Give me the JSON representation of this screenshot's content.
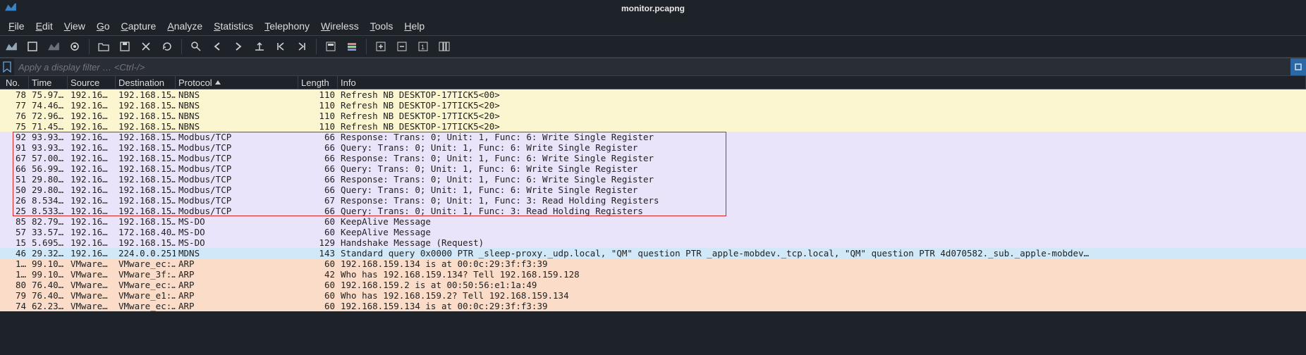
{
  "title": "monitor.pcapng",
  "menu": [
    "File",
    "Edit",
    "View",
    "Go",
    "Capture",
    "Analyze",
    "Statistics",
    "Telephony",
    "Wireless",
    "Tools",
    "Help"
  ],
  "filter_placeholder": "Apply a display filter … <Ctrl-/>",
  "columns": [
    "No.",
    "Time",
    "Source",
    "Destination",
    "Protocol",
    "Length",
    "Info"
  ],
  "sort_column": "Protocol",
  "toolbar_icons": [
    "fin-icon",
    "stop-icon",
    "restart-icon",
    "options-icon",
    "open-icon",
    "save-icon",
    "close-icon",
    "reload-icon",
    "find-icon",
    "back-icon",
    "forward-icon",
    "jump-icon",
    "first-icon",
    "last-icon",
    "autoscroll-icon",
    "colorize-icon",
    "zoom-in-icon",
    "zoom-out-icon",
    "reset-zoom-icon",
    "resize-icon"
  ],
  "packets": [
    {
      "no": "78",
      "time": "75.97…",
      "src": "192.16…",
      "dst": "192.168.15…",
      "proto": "NBNS",
      "len": "110",
      "info": "Refresh NB DESKTOP-17TICK5<00>",
      "cls": "bg-nbns"
    },
    {
      "no": "77",
      "time": "74.46…",
      "src": "192.16…",
      "dst": "192.168.15…",
      "proto": "NBNS",
      "len": "110",
      "info": "Refresh NB DESKTOP-17TICK5<20>",
      "cls": "bg-nbns"
    },
    {
      "no": "76",
      "time": "72.96…",
      "src": "192.16…",
      "dst": "192.168.15…",
      "proto": "NBNS",
      "len": "110",
      "info": "Refresh NB DESKTOP-17TICK5<20>",
      "cls": "bg-nbns"
    },
    {
      "no": "75",
      "time": "71.45…",
      "src": "192.16…",
      "dst": "192.168.15…",
      "proto": "NBNS",
      "len": "110",
      "info": "Refresh NB DESKTOP-17TICK5<20>",
      "cls": "bg-nbns"
    },
    {
      "no": "92",
      "time": "93.93…",
      "src": "192.16…",
      "dst": "192.168.15…",
      "proto": "Modbus/TCP",
      "len": "66",
      "info": "Response: Trans:     0; Unit:   1, Func:   6: Write Single Register",
      "cls": "bg-modbus",
      "hl": true
    },
    {
      "no": "91",
      "time": "93.93…",
      "src": "192.16…",
      "dst": "192.168.15…",
      "proto": "Modbus/TCP",
      "len": "66",
      "info": "   Query: Trans:     0; Unit:   1, Func:   6: Write Single Register",
      "cls": "bg-modbus",
      "hl": true
    },
    {
      "no": "67",
      "time": "57.00…",
      "src": "192.16…",
      "dst": "192.168.15…",
      "proto": "Modbus/TCP",
      "len": "66",
      "info": "Response: Trans:     0; Unit:   1, Func:   6: Write Single Register",
      "cls": "bg-modbus",
      "hl": true
    },
    {
      "no": "66",
      "time": "56.99…",
      "src": "192.16…",
      "dst": "192.168.15…",
      "proto": "Modbus/TCP",
      "len": "66",
      "info": "   Query: Trans:     0; Unit:   1, Func:   6: Write Single Register",
      "cls": "bg-modbus",
      "hl": true
    },
    {
      "no": "51",
      "time": "29.80…",
      "src": "192.16…",
      "dst": "192.168.15…",
      "proto": "Modbus/TCP",
      "len": "66",
      "info": "Response: Trans:     0; Unit:   1, Func:   6: Write Single Register",
      "cls": "bg-modbus",
      "hl": true
    },
    {
      "no": "50",
      "time": "29.80…",
      "src": "192.16…",
      "dst": "192.168.15…",
      "proto": "Modbus/TCP",
      "len": "66",
      "info": "   Query: Trans:     0; Unit:   1, Func:   6: Write Single Register",
      "cls": "bg-modbus",
      "hl": true
    },
    {
      "no": "26",
      "time": "8.534…",
      "src": "192.16…",
      "dst": "192.168.15…",
      "proto": "Modbus/TCP",
      "len": "67",
      "info": "Response: Trans:     0; Unit:   1, Func:   3: Read Holding Registers",
      "cls": "bg-modbus",
      "hl": true
    },
    {
      "no": "25",
      "time": "8.533…",
      "src": "192.16…",
      "dst": "192.168.15…",
      "proto": "Modbus/TCP",
      "len": "66",
      "info": "   Query: Trans:     0; Unit:   1, Func:   3: Read Holding Registers",
      "cls": "bg-modbus",
      "hl": true
    },
    {
      "no": "85",
      "time": "82.79…",
      "src": "192.16…",
      "dst": "192.168.15…",
      "proto": "MS-DO",
      "len": "60",
      "info": "KeepAlive Message",
      "cls": "bg-msdo"
    },
    {
      "no": "57",
      "time": "33.57…",
      "src": "192.16…",
      "dst": "172.168.40…",
      "proto": "MS-DO",
      "len": "60",
      "info": "KeepAlive Message",
      "cls": "bg-msdo"
    },
    {
      "no": "15",
      "time": "5.695…",
      "src": "192.16…",
      "dst": "192.168.15…",
      "proto": "MS-DO",
      "len": "129",
      "info": "Handshake Message (Request)",
      "cls": "bg-msdo"
    },
    {
      "no": "46",
      "time": "29.32…",
      "src": "192.16…",
      "dst": "224.0.0.251",
      "proto": "MDNS",
      "len": "143",
      "info": "Standard query 0x0000 PTR _sleep-proxy._udp.local, \"QM\" question PTR _apple-mobdev._tcp.local, \"QM\" question PTR 4d070582._sub._apple-mobdev…",
      "cls": "bg-mdns"
    },
    {
      "no": "1…",
      "time": "99.10…",
      "src": "VMware…",
      "dst": "VMware_ec:…",
      "proto": "ARP",
      "len": "60",
      "info": "192.168.159.134 is at 00:0c:29:3f:f3:39",
      "cls": "bg-arp"
    },
    {
      "no": "1…",
      "time": "99.10…",
      "src": "VMware…",
      "dst": "VMware_3f:…",
      "proto": "ARP",
      "len": "42",
      "info": "Who has 192.168.159.134? Tell 192.168.159.128",
      "cls": "bg-arp"
    },
    {
      "no": "80",
      "time": "76.40…",
      "src": "VMware…",
      "dst": "VMware_ec:…",
      "proto": "ARP",
      "len": "60",
      "info": "192.168.159.2 is at 00:50:56:e1:1a:49",
      "cls": "bg-arp"
    },
    {
      "no": "79",
      "time": "76.40…",
      "src": "VMware…",
      "dst": "VMware_e1:…",
      "proto": "ARP",
      "len": "60",
      "info": "Who has 192.168.159.2? Tell 192.168.159.134",
      "cls": "bg-arp"
    },
    {
      "no": "74",
      "time": "62.23…",
      "src": "VMware…",
      "dst": "VMware_ec:…",
      "proto": "ARP",
      "len": "60",
      "info": "192.168.159.134 is at 00:0c:29:3f:f3:39",
      "cls": "bg-arp"
    }
  ]
}
